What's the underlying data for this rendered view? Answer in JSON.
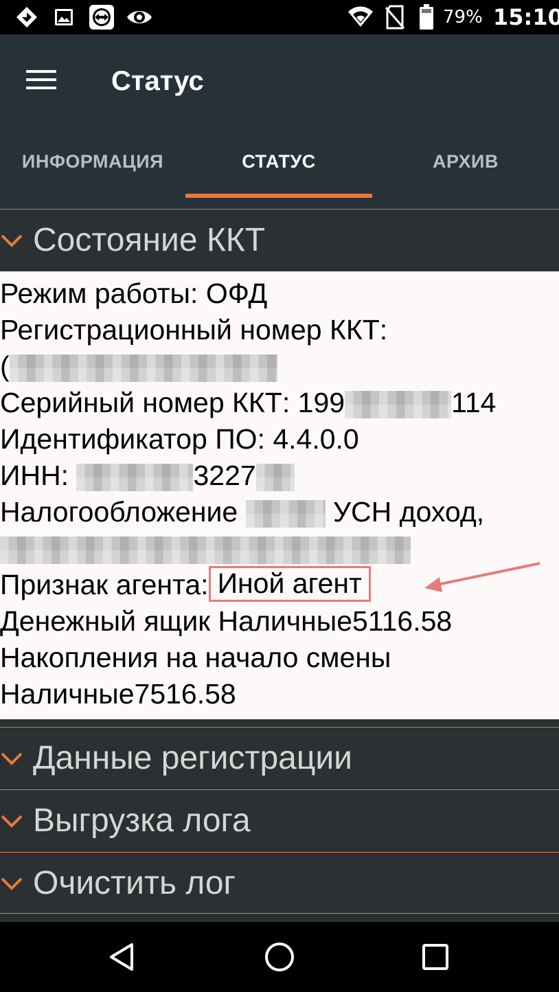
{
  "status_bar": {
    "battery_percent": "79%",
    "time": "15:10",
    "icons": [
      "apps-diamond-icon",
      "image-icon",
      "remote-control-icon",
      "eye-icon",
      "wifi-icon",
      "no-sim-icon",
      "battery-icon"
    ]
  },
  "toolbar": {
    "title": "Статус",
    "menu_icon": "hamburger-menu-icon"
  },
  "tabs": [
    {
      "label": "ИНФОРМАЦИЯ",
      "selected": false
    },
    {
      "label": "СТАТУС",
      "selected": true
    },
    {
      "label": "АРХИВ",
      "selected": false
    }
  ],
  "colors": {
    "accent": "#f0763a",
    "toolbar_bg": "#263238",
    "content_bg": "#fcf9f8",
    "highlight": "#e67b7b"
  },
  "sections": [
    {
      "title": "Состояние ККТ",
      "expanded": true
    },
    {
      "title": "Данные регистрации",
      "expanded": false
    },
    {
      "title": "Выгрузка лога",
      "expanded": false
    },
    {
      "title": "Очистить лог",
      "expanded": false
    }
  ],
  "kkt_state": {
    "mode": "Режим работы: ОФД",
    "reg_number_label": "Регистрационный номер ККТ:",
    "reg_number_prefix": "(",
    "serial_label": "Серийный номер ККТ: 199",
    "serial_suffix": "114",
    "software_id": "Идентификатор ПО: 4.4.0.0",
    "inn_label": "ИНН: ",
    "inn_visible": "3227",
    "tax_label": "Налогообложение ",
    "tax_visible": "УСН доход,",
    "agent_label": "Признак агента:",
    "agent_value": "Иной агент",
    "cash_drawer": "Денежный ящик Наличные5116.58",
    "accumulation_label": "Накопления на начало смены",
    "accumulation_value": "Наличные7516.58"
  },
  "nav_bar": {
    "back_icon": "back-triangle-icon",
    "home_icon": "home-circle-icon",
    "recents_icon": "recents-square-icon"
  }
}
